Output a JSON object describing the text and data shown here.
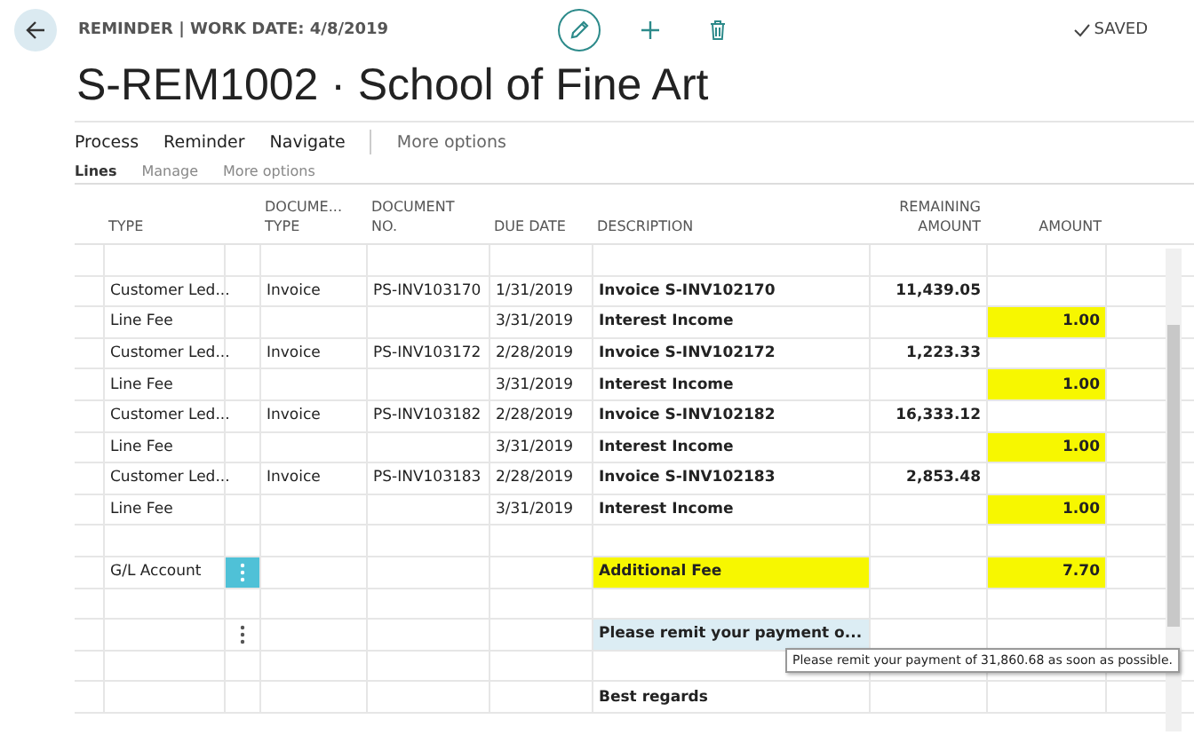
{
  "header": {
    "caption": "REMINDER | WORK DATE: 4/8/2019",
    "title": "S-REM1002 · School of Fine Art",
    "status": "SAVED"
  },
  "actions": [
    {
      "label": "Process",
      "kind": "action"
    },
    {
      "label": "Reminder",
      "kind": "action"
    },
    {
      "label": "Navigate",
      "kind": "action"
    },
    {
      "label": "More options",
      "kind": "more"
    }
  ],
  "lines_bar": [
    {
      "label": "Lines",
      "kind": "title"
    },
    {
      "label": "Manage",
      "kind": "action"
    },
    {
      "label": "More options",
      "kind": "more"
    }
  ],
  "table": {
    "columns": [
      "TYPE",
      "DOCUME... TYPE",
      "DOCUMENT NO.",
      "DUE DATE",
      "DESCRIPTION",
      "REMAINING AMOUNT",
      "AMOUNT"
    ],
    "rows": [
      {
        "type": "",
        "doc_type": "",
        "doc_no": "",
        "due_date": "",
        "description": "",
        "remaining": "",
        "amount": ""
      },
      {
        "type": "Customer Led...",
        "doc_type": "Invoice",
        "doc_no": "PS-INV103170",
        "due_date": "1/31/2019",
        "description": "Invoice S-INV102170",
        "remaining": "11,439.05",
        "amount": ""
      },
      {
        "type": "Line Fee",
        "doc_type": "",
        "doc_no": "",
        "due_date": "3/31/2019",
        "description": "Interest Income",
        "remaining": "",
        "amount": "1.00",
        "highlighted": true
      },
      {
        "type": "Customer Led...",
        "doc_type": "Invoice",
        "doc_no": "PS-INV103172",
        "due_date": "2/28/2019",
        "description": "Invoice S-INV102172",
        "remaining": "1,223.33",
        "amount": ""
      },
      {
        "type": "Line Fee",
        "doc_type": "",
        "doc_no": "",
        "due_date": "3/31/2019",
        "description": "Interest Income",
        "remaining": "",
        "amount": "1.00",
        "highlighted": true
      },
      {
        "type": "Customer Led...",
        "doc_type": "Invoice",
        "doc_no": "PS-INV103182",
        "due_date": "2/28/2019",
        "description": "Invoice S-INV102182",
        "remaining": "16,333.12",
        "amount": ""
      },
      {
        "type": "Line Fee",
        "doc_type": "",
        "doc_no": "",
        "due_date": "3/31/2019",
        "description": "Interest Income",
        "remaining": "",
        "amount": "1.00",
        "highlighted": true
      },
      {
        "type": "Customer Led...",
        "doc_type": "Invoice",
        "doc_no": "PS-INV103183",
        "due_date": "2/28/2019",
        "description": "Invoice S-INV102183",
        "remaining": "2,853.48",
        "amount": ""
      },
      {
        "type": "Line Fee",
        "doc_type": "",
        "doc_no": "",
        "due_date": "3/31/2019",
        "description": "Interest Income",
        "remaining": "",
        "amount": "1.00",
        "highlighted": true
      },
      {
        "type": "",
        "doc_type": "",
        "doc_no": "",
        "due_date": "",
        "description": "",
        "remaining": "",
        "amount": ""
      },
      {
        "type": "G/L Account",
        "doc_type": "",
        "doc_no": "",
        "due_date": "",
        "description": "Additional Fee",
        "remaining": "",
        "amount": "7.70",
        "highlighted": true,
        "description_highlighted": true,
        "menu": true,
        "selected": true
      },
      {
        "type": "",
        "doc_type": "",
        "doc_no": "",
        "due_date": "",
        "description": "",
        "remaining": "",
        "amount": ""
      },
      {
        "type": "",
        "doc_type": "",
        "doc_no": "",
        "due_date": "",
        "description": "Please remit your payment o...",
        "remaining": "",
        "amount": "",
        "menu": true,
        "focused": true,
        "selected": false,
        "tooltip": "Please remit your payment of 31,860.68 as soon as possible."
      },
      {
        "type": "",
        "doc_type": "",
        "doc_no": "",
        "due_date": "",
        "description": "",
        "remaining": "",
        "amount": ""
      },
      {
        "type": "",
        "doc_type": "",
        "doc_no": "",
        "due_date": "",
        "description": "Best regards",
        "remaining": "",
        "amount": ""
      }
    ]
  }
}
